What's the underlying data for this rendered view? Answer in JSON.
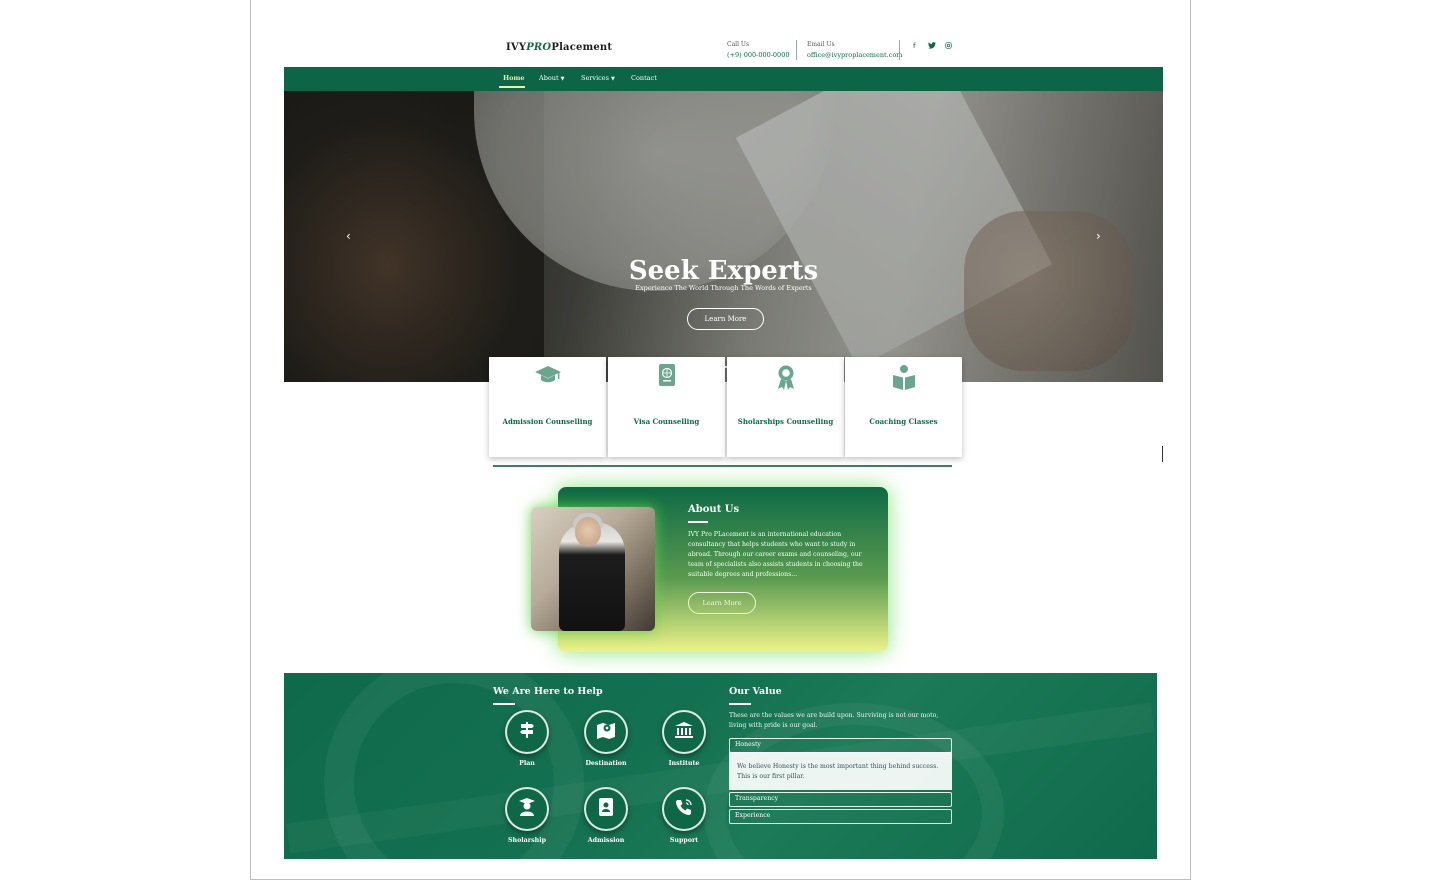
{
  "header": {
    "logo_prefix": "IVY",
    "logo_pro": "PRO",
    "logo_suffix": "Placement",
    "call_label": "Call Us",
    "call_value": "(+9) 000-000-0000",
    "email_label": "Email Us",
    "email_value": "office@ivyproplacement.com",
    "social_icons": [
      "facebook-icon",
      "twitter-icon",
      "instagram-icon"
    ]
  },
  "nav": {
    "items": [
      {
        "label": "Home",
        "active": true
      },
      {
        "label": "About",
        "dropdown": true
      },
      {
        "label": "Services",
        "dropdown": true
      },
      {
        "label": "Contact"
      }
    ]
  },
  "hero": {
    "title": "Seek Experts",
    "subtitle": "Experience The World Through The Words of Experts",
    "button": "Learn More",
    "prev_icon": "chevron-left-icon",
    "next_icon": "chevron-right-icon",
    "slide_count": 3,
    "active_slide": 2
  },
  "services": [
    {
      "label": "Admission Counselling",
      "icon": "graduation-cap-icon"
    },
    {
      "label": "Visa Counselling",
      "icon": "passport-icon"
    },
    {
      "label": "Sholarships Counselling",
      "icon": "award-icon"
    },
    {
      "label": "Coaching Classes",
      "icon": "book-reader-icon"
    }
  ],
  "about": {
    "title": "About Us",
    "text": "IVY Pro PLacement is an international education consultancy that helps students who want to study in abroad. Through our career exams and counseling, our team of specialists also assists students in choosing the suitable degrees and professions...",
    "button": "Learn More"
  },
  "help": {
    "title": "We Are Here to Help",
    "items": [
      {
        "label": "Plan",
        "icon": "signpost-icon"
      },
      {
        "label": "Destination",
        "icon": "map-pin-icon"
      },
      {
        "label": "Institute",
        "icon": "institution-icon"
      },
      {
        "label": "Sholarship",
        "icon": "graduate-icon"
      },
      {
        "label": "Admission",
        "icon": "id-badge-icon"
      },
      {
        "label": "Support",
        "icon": "phone-volume-icon"
      }
    ]
  },
  "values": {
    "title": "Our Value",
    "intro": "These are the values we are build upon. Surviving is not our moto, living with pride is our goal.",
    "accordion": [
      {
        "label": "Honesty",
        "open": true,
        "body": "We believe Honesty is the most important thing behind success. This is our first pillar."
      },
      {
        "label": "Transparency",
        "open": false
      },
      {
        "label": "Experience",
        "open": false
      }
    ]
  },
  "colors": {
    "brand_green": "#0c6547",
    "accent_yellow": "#f3e9a0",
    "about_gradient_end": "#eef38a"
  }
}
